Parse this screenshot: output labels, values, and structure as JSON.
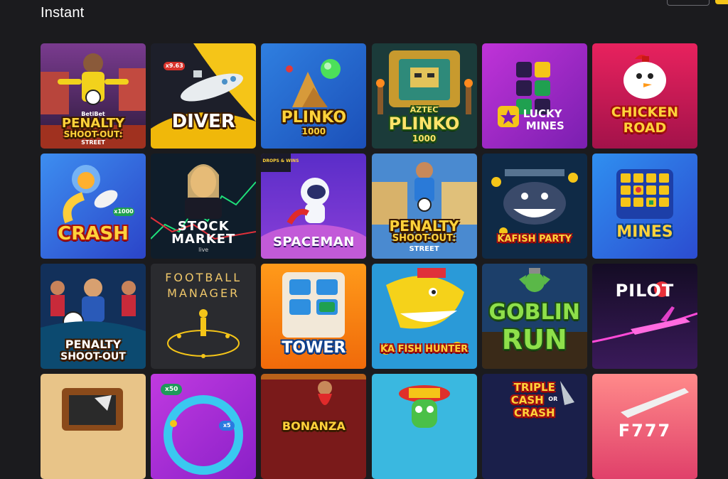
{
  "section": {
    "title": "Instant"
  },
  "games": [
    {
      "id": "penalty-shootout-street-betibet",
      "lines": [
        "BetiBet",
        "PENALTY",
        "SHOOT-OUT:",
        "STREET"
      ]
    },
    {
      "id": "diver",
      "lines": [
        "DIVER"
      ],
      "badge": "x9.63"
    },
    {
      "id": "plinko-1000",
      "lines": [
        "PLINKO",
        "1000"
      ]
    },
    {
      "id": "aztec-plinko-1000",
      "lines": [
        "AZTEC",
        "PLINKO",
        "1000"
      ]
    },
    {
      "id": "lucky-mines",
      "lines": [
        "LUCKY",
        "MINES"
      ]
    },
    {
      "id": "chicken-road",
      "lines": [
        "CHICKEN",
        "ROAD"
      ]
    },
    {
      "id": "crash",
      "lines": [
        "CRASH"
      ],
      "badge": "x1000"
    },
    {
      "id": "stock-market",
      "lines": [
        "STOCK",
        "MARKET",
        "live"
      ]
    },
    {
      "id": "spaceman",
      "lines": [
        "SPACEMAN"
      ],
      "badge": "DROPS & WINS"
    },
    {
      "id": "penalty-shootout-street",
      "lines": [
        "PENALTY",
        "SHOOT-OUT:",
        "STREET"
      ]
    },
    {
      "id": "kafish-party",
      "lines": [
        "KAFISH PARTY"
      ]
    },
    {
      "id": "mines",
      "lines": [
        "MINES"
      ]
    },
    {
      "id": "penalty-shootout",
      "lines": [
        "PENALTY",
        "SHOOT-OUT"
      ]
    },
    {
      "id": "football-manager",
      "lines": [
        "FOOTBALL",
        "MANAGER"
      ]
    },
    {
      "id": "tower",
      "lines": [
        "TOWER"
      ]
    },
    {
      "id": "kafish-hunter",
      "lines": [
        "KA FISH HUNTER"
      ]
    },
    {
      "id": "goblin-run",
      "lines": [
        "GOBLIN",
        "RUN"
      ]
    },
    {
      "id": "pilot",
      "lines": [
        "PILOT"
      ]
    },
    {
      "id": "tv-game",
      "lines": []
    },
    {
      "id": "x50-wheel",
      "lines": [],
      "badge": "x50",
      "badge2": "x5"
    },
    {
      "id": "bonanza",
      "lines": [
        "BONANZA"
      ]
    },
    {
      "id": "cactus-game",
      "lines": []
    },
    {
      "id": "triple-cash-or-crash",
      "lines": [
        "TRIPLE",
        "CASH",
        "OR",
        "CRASH"
      ]
    },
    {
      "id": "jet-777",
      "lines": [
        "F777"
      ]
    }
  ],
  "colors": {
    "page_bg": "#1b1b1e",
    "accent": "#f5c518",
    "title": "#ffffff"
  }
}
